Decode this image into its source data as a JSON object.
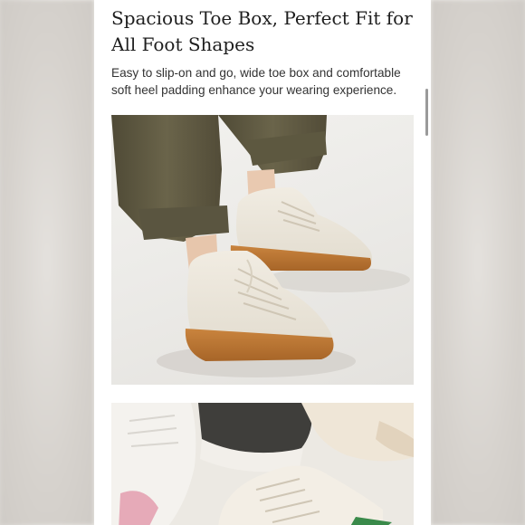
{
  "section": {
    "heading": "Spacious Toe Box, Perfect Fit for All Foot Shapes",
    "description": "Easy to slip-on and go, wide toe box and comfortable soft heel padding enhance your wearing experience."
  },
  "colors": {
    "page_background": "#ffffff",
    "heading_text": "#1e1e1e",
    "body_text": "#333333",
    "scrollbar": "#9a9a9a"
  }
}
